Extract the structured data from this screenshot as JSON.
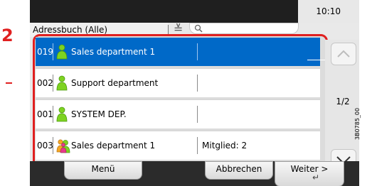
{
  "annotation": {
    "step_number": "2"
  },
  "status_bar": {
    "time": "10:10"
  },
  "header": {
    "address_book_label": "Adressbuch (Alle)"
  },
  "list": {
    "rows": [
      {
        "number": "019",
        "name": "Sales department 1",
        "member": "",
        "icon": "user-icon",
        "selected": true
      },
      {
        "number": "002",
        "name": "Support department",
        "member": "",
        "icon": "user-icon",
        "selected": false
      },
      {
        "number": "001",
        "name": "SYSTEM DEP.",
        "member": "",
        "icon": "user-icon",
        "selected": false
      },
      {
        "number": "003",
        "name": "Sales department 1",
        "member": "Mitglied: 2",
        "icon": "group-icon",
        "selected": false
      }
    ]
  },
  "pagination": {
    "page_indicator": "1/2"
  },
  "buttons": {
    "menu": "Menü",
    "cancel": "Abbrechen",
    "next": "Weiter >"
  },
  "figure_id": "3B0785_00",
  "colors": {
    "selected_row": "#0069c8",
    "highlight_frame": "#e02020",
    "user_icon": "#7ed321"
  }
}
